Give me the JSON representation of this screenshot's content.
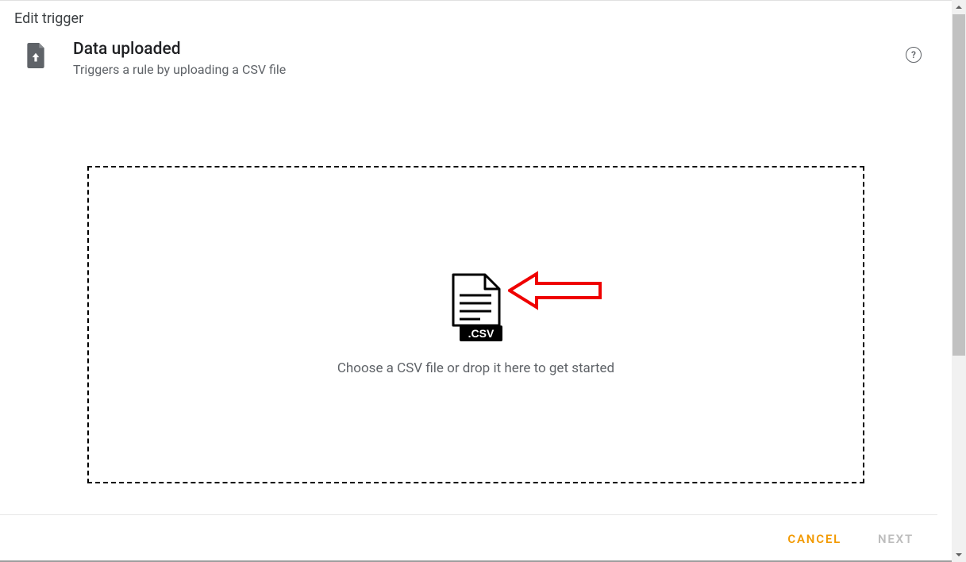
{
  "page": {
    "title": "Edit trigger"
  },
  "trigger": {
    "name": "Data uploaded",
    "description": "Triggers a rule by uploading a CSV file"
  },
  "dropzone": {
    "prompt": "Choose a CSV file or drop it here to get started",
    "icon_badge": ".CSV"
  },
  "footer": {
    "cancel": "CANCEL",
    "next": "NEXT"
  },
  "help": {
    "glyph": "?"
  }
}
